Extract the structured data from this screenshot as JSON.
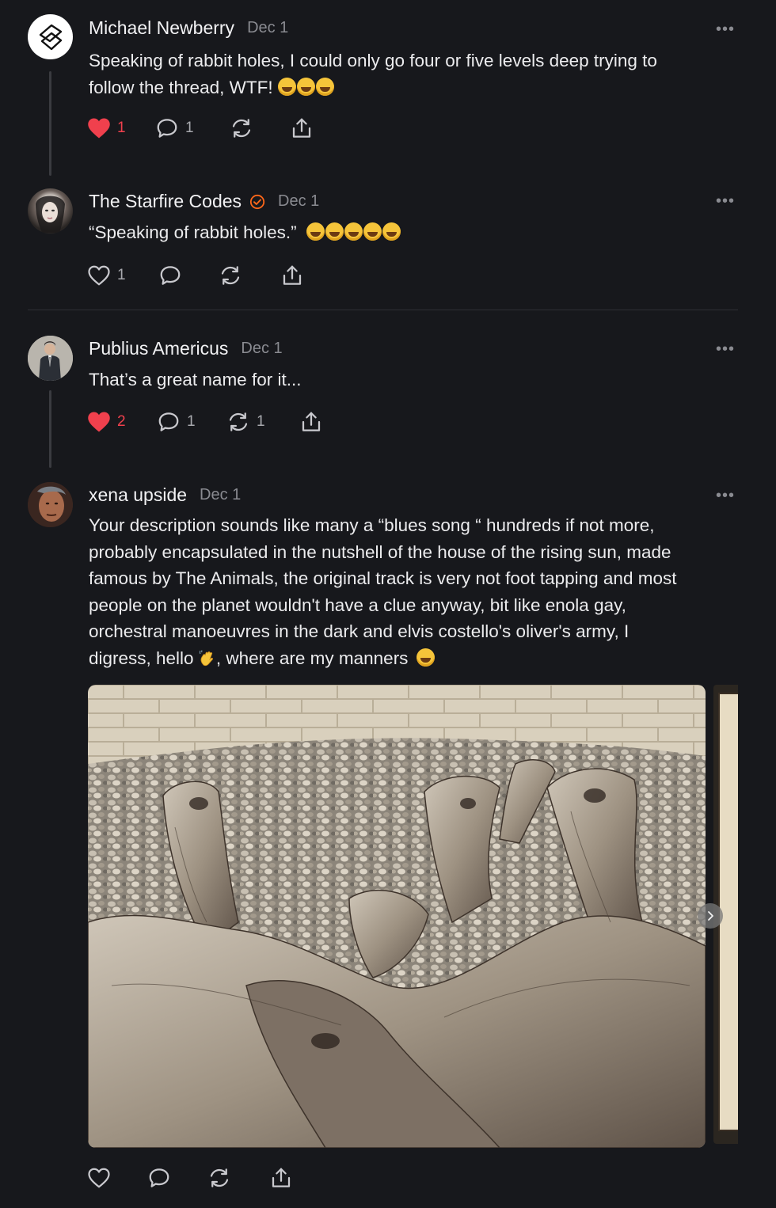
{
  "posts": [
    {
      "author": "Michael Newberry",
      "date": "Dec 1",
      "text_lines": [
        "Speaking of rabbit holes, I could only go four or five levels deep trying to",
        "follow the thread, WTF!"
      ],
      "likes": "1",
      "comments": "1",
      "restacks": "",
      "liked": true
    },
    {
      "author": "The Starfire Codes",
      "date": "Dec 1",
      "text": "“Speaking of rabbit holes.”",
      "likes": "1",
      "comments": "",
      "restacks": "",
      "liked": false
    },
    {
      "author": "Publius Americus",
      "date": "Dec 1",
      "text": "That’s a great name for it...",
      "likes": "2",
      "comments": "1",
      "restacks": "1",
      "liked": true
    },
    {
      "author": "xena upside",
      "date": "Dec 1",
      "text_lines": [
        "Your description sounds like many a “blues song “ hundreds if not more,",
        "probably encapsulated in the nutshell of the house of the rising sun, made",
        "famous by The Animals, the original track is very not foot tapping and most",
        "people on the planet wouldn't have a clue anyway, bit like enola gay,",
        "orchestral manoeuvres in the dark and elvis costello's oliver's army, I",
        "digress, hello",
        ", where are my manners"
      ],
      "likes": "",
      "comments": "",
      "restacks": "",
      "liked": false
    }
  ],
  "more_label": "•••",
  "colors": {
    "background": "#17181c",
    "like": "#f0404d",
    "muted": "#8a8b91",
    "verified": "#ff6719"
  }
}
